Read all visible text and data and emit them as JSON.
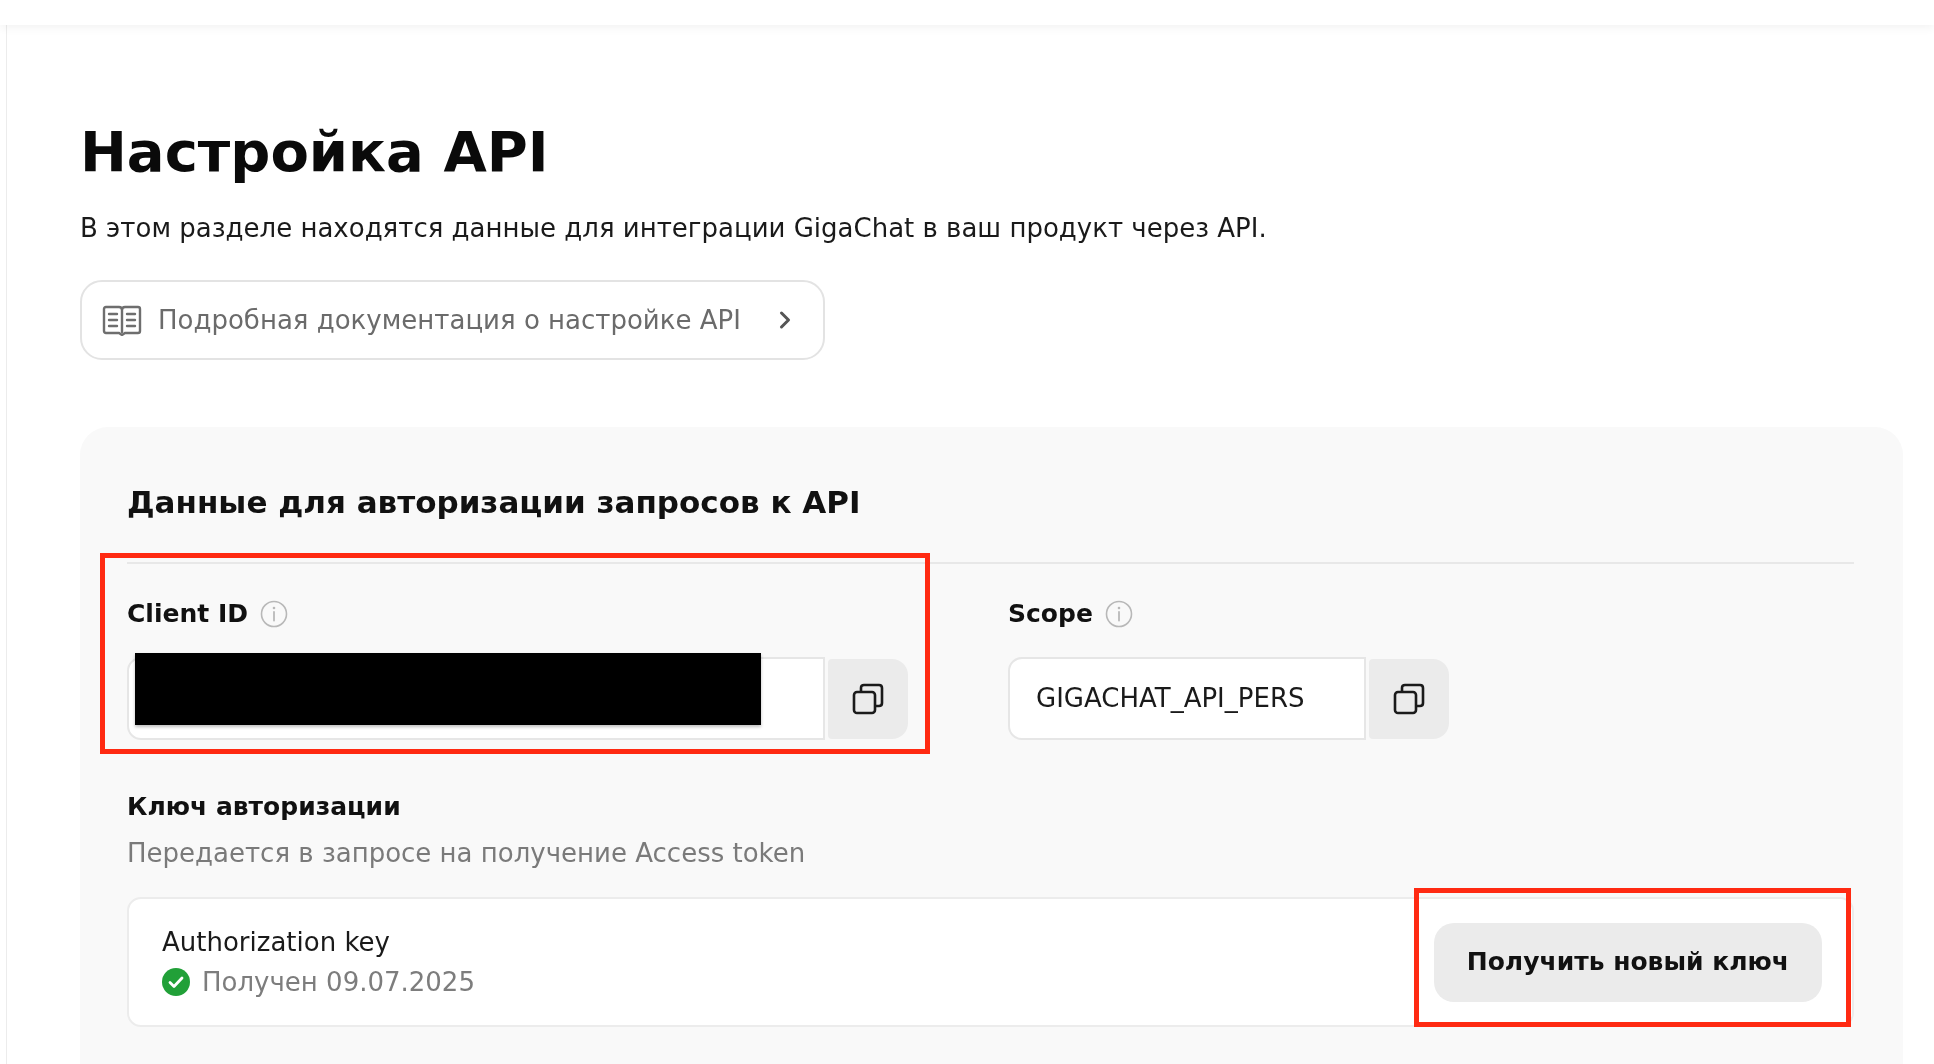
{
  "page": {
    "title": "Настройка API",
    "description": "В этом разделе находятся данные для интеграции GigaChat в ваш продукт через API."
  },
  "docs_link": {
    "label": "Подробная документация о настройке API"
  },
  "auth_card": {
    "title": "Данные для авторизации запросов к API",
    "fields": [
      {
        "label": "Client ID",
        "redacted": true,
        "highlighted": true
      },
      {
        "label": "Scope",
        "value": "GIGACHAT_API_PERS",
        "redacted": false,
        "highlighted": false
      }
    ],
    "auth_key_section": {
      "title": "Ключ авторизации",
      "hint": "Передается в запросе на получение Access token",
      "key": {
        "label": "Authorization key",
        "status": "Получен 09.07.2025",
        "received": true
      },
      "button": {
        "label": "Получить новый ключ",
        "highlighted": true
      }
    }
  }
}
